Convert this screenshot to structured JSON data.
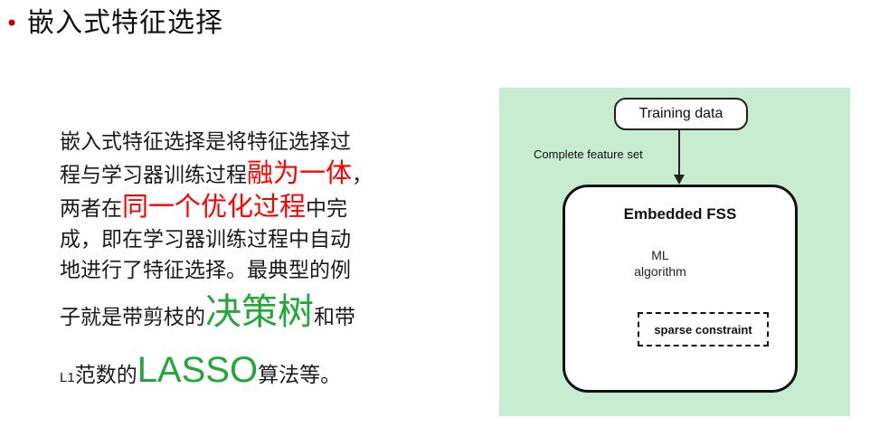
{
  "slide": {
    "bullet": "•",
    "title": "嵌入式特征选择"
  },
  "body": {
    "line1": "嵌入式特征选择是将特征选择过",
    "line2_pre": "程与学习器训练过程",
    "line2_emph": "融为一体",
    "line2_post": "，",
    "line3_pre": "两者在",
    "line3_emph": "同一个优化过程",
    "line3_post": "中完",
    "line4": "成，即在学习器训练过程中自动",
    "line5": "地进行了特征选择。最典型的例",
    "line6_pre": "子就是带剪枝的",
    "line6_emph": "决策树",
    "line6_post": "和带",
    "line7_pre_latin": "L1",
    "line7_pre": "范数的",
    "line7_emph": "LASSO",
    "line7_post": "算法等。"
  },
  "diagram": {
    "training_data": "Training data",
    "feature_set_label": "Complete feature set",
    "fss_title": "Embedded FSS",
    "ml_line1": "ML",
    "ml_line2": "algorithm",
    "sparse_constraint": "sparse constraint"
  },
  "colors": {
    "bullet": "#c00000",
    "emphasis_red": "#ff0000",
    "emphasis_green": "#22a83a",
    "diagram_background": "#c8ecd0"
  }
}
